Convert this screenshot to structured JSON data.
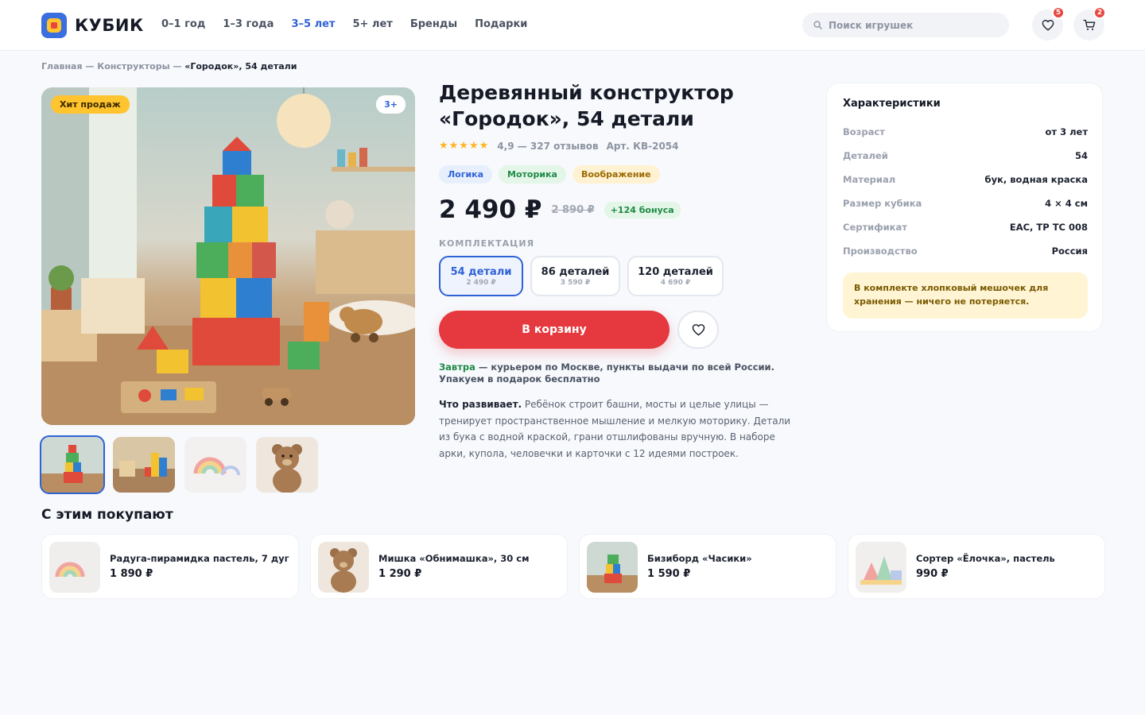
{
  "brand": {
    "name": "КУБИК"
  },
  "nav": [
    {
      "label": "0–1 год",
      "active": false
    },
    {
      "label": "1–3 года",
      "active": false
    },
    {
      "label": "3–5 лет",
      "active": true
    },
    {
      "label": "5+ лет",
      "active": false
    },
    {
      "label": "Бренды",
      "active": false
    },
    {
      "label": "Подарки",
      "active": false
    }
  ],
  "search": {
    "placeholder": "Поиск игрушек",
    "icon": "search-icon"
  },
  "header_icons": {
    "favorites": {
      "icon": "heart-icon",
      "count": "5"
    },
    "cart": {
      "icon": "cart-icon",
      "count": "2"
    }
  },
  "breadcrumb": {
    "items": [
      "Главная",
      "Конструкторы"
    ],
    "separator": "—",
    "current": "«Городок», 54 детали"
  },
  "gallery": {
    "tag_hit": "Хит продаж",
    "tag_age": "3+",
    "thumbs": [
      "конструктор-башня",
      "кубики-сцена",
      "радуга-пирамидка",
      "плюшевый-мишка"
    ],
    "selected": 0
  },
  "product": {
    "title": "Деревянный конструктор «Городок», 54 детали",
    "rating": "4,9",
    "reviews": "327 отзывов",
    "article": "Арт. КВ-2054",
    "stars": "★★★★★",
    "tags": [
      {
        "label": "Логика",
        "bg": "#e7effd",
        "fg": "#2f62d6"
      },
      {
        "label": "Моторика",
        "bg": "#e3f6e8",
        "fg": "#1f8a46"
      },
      {
        "label": "Воображение",
        "bg": "#fff2d2",
        "fg": "#9a6a00"
      }
    ],
    "price": "2 490 ₽",
    "old_price": "2 890 ₽",
    "bonus": "+124 бонуса",
    "kit_label": "КОМПЛЕКТАЦИЯ",
    "options": [
      {
        "name": "54 детали",
        "price": "2 490 ₽",
        "selected": true
      },
      {
        "name": "86 деталей",
        "price": "3 590 ₽",
        "selected": false
      },
      {
        "name": "120 деталей",
        "price": "4 690 ₽",
        "selected": false
      }
    ],
    "cart_button": "В корзину",
    "delivery_highlight": "Завтра",
    "delivery_text": " — курьером по Москве, пункты выдачи по всей России. Упакуем в подарок бесплатно",
    "desc_lead": "Что развивает.",
    "desc_text": " Ребёнок строит башни, мосты и целые улицы — тренирует пространственное мышление и мелкую моторику. Детали из бука с водной краской, грани отшлифованы вручную. В наборе арки, купола, человечки и карточки с 12 идеями построек."
  },
  "specs": {
    "title": "Характеристики",
    "rows": [
      {
        "k": "Возраст",
        "v": "от 3 лет"
      },
      {
        "k": "Деталей",
        "v": "54"
      },
      {
        "k": "Материал",
        "v": "бук, водная краска"
      },
      {
        "k": "Размер кубика",
        "v": "4 × 4 см"
      },
      {
        "k": "Сертификат",
        "v": "EAC, ТР ТС 008"
      },
      {
        "k": "Производство",
        "v": "Россия"
      }
    ],
    "note": "В комплекте хлопковый мешочек для хранения — ничего не потеряется."
  },
  "related": {
    "title": "С этим покупают",
    "items": [
      {
        "name": "Радуга-пирамидка пастель, 7 дуг",
        "price": "1 890 ₽",
        "image": "радуга-пирамидка"
      },
      {
        "name": "Мишка «Обнимашка», 30 см",
        "price": "1 290 ₽",
        "image": "плюшевый-мишка"
      },
      {
        "name": "Бизиборд «Часики»",
        "price": "1 590 ₽",
        "image": "конструктор-башня"
      },
      {
        "name": "Сортер «Ёлочка», пастель",
        "price": "990 ₽",
        "image": "сортер-пастель"
      }
    ]
  }
}
